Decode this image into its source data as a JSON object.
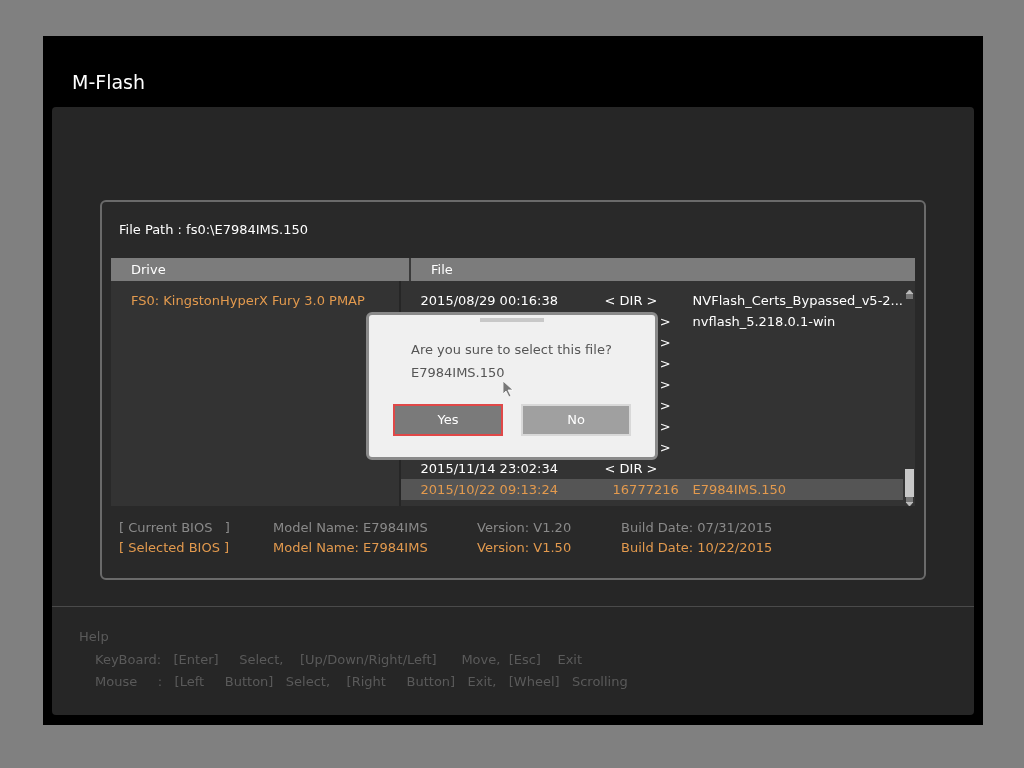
{
  "window": {
    "title": "M-Flash"
  },
  "file_path": "File Path : fs0:\\E7984IMS.150",
  "table": {
    "columns": [
      "Drive",
      "File"
    ],
    "drives": [
      {
        "label": "FS0: KingstonHyperX Fury 3.0 PMAP",
        "selected": true
      }
    ],
    "files": [
      {
        "kind": "entry",
        "date": "2015/08/29 00:16:38",
        "size": "< DIR >",
        "name": "NVFlash_Certs_Bypassed_v5-2...",
        "selected": false
      },
      {
        "kind": "covered",
        "size": ">",
        "name": "nvflash_5.218.0.1-win",
        "selected": false
      },
      {
        "kind": "covered",
        "size": ">",
        "selected": false
      },
      {
        "kind": "covered",
        "size": ">",
        "selected": false
      },
      {
        "kind": "covered",
        "size": ">",
        "selected": false
      },
      {
        "kind": "covered",
        "size": ">",
        "selected": false
      },
      {
        "kind": "covered",
        "size": ">",
        "selected": false
      },
      {
        "kind": "covered",
        "size": ">",
        "selected": false
      },
      {
        "kind": "entry",
        "date": "2015/11/14 23:02:34",
        "size": "< DIR >",
        "selected": false
      },
      {
        "kind": "entry",
        "date": "2015/10/22 09:13:24",
        "size": "16777216",
        "name": "E7984IMS.150",
        "selected": true
      }
    ]
  },
  "bios": [
    {
      "label": "[ Current BIOS   ]",
      "model": "Model Name: E7984IMS",
      "version": "Version: V1.20",
      "date": "Build Date: 07/31/2015",
      "selected": false
    },
    {
      "label": "[ Selected BIOS ]",
      "model": "Model Name: E7984IMS",
      "version": "Version: V1.50",
      "date": "Build Date: 10/22/2015",
      "selected": true
    }
  ],
  "help": {
    "title": "Help",
    "rows": [
      "KeyBoard:   [Enter]     Select,    [Up/Down/Right/Left]      Move,  [Esc]    Exit",
      "Mouse     :   [Left     Button]   Select,    [Right     Button]   Exit,   [Wheel]   Scrolling"
    ]
  },
  "dialog": {
    "message": "Are you sure to select this file?",
    "file": "E7984IMS.150",
    "buttons": [
      {
        "label": "Yes",
        "selected": true
      },
      {
        "label": "No",
        "selected": false
      }
    ]
  }
}
